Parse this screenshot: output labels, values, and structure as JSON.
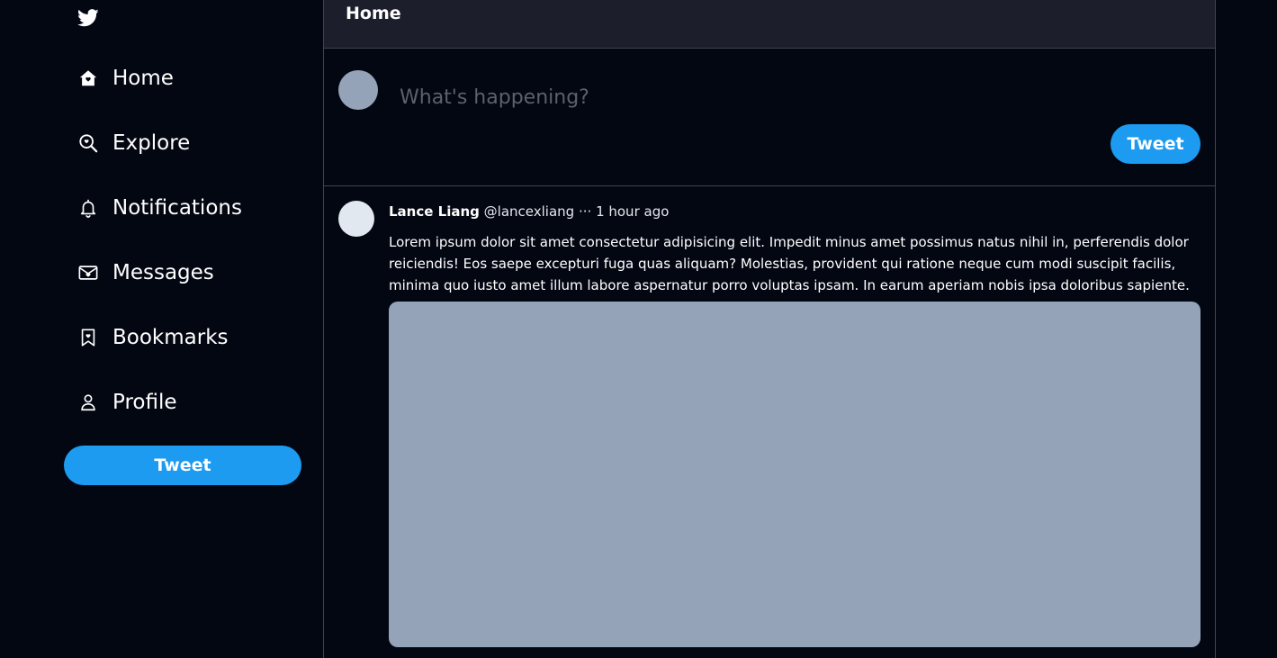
{
  "sidebar": {
    "logo_icon": "twitter-bird-icon",
    "items": [
      {
        "label": "Home",
        "icon": "home-icon"
      },
      {
        "label": "Explore",
        "icon": "explore-search-icon"
      },
      {
        "label": "Notifications",
        "icon": "bell-icon"
      },
      {
        "label": "Messages",
        "icon": "envelope-icon"
      },
      {
        "label": "Bookmarks",
        "icon": "bookmark-icon"
      },
      {
        "label": "Profile",
        "icon": "user-icon"
      }
    ],
    "tweet_button": "Tweet"
  },
  "header": {
    "title": "Home"
  },
  "composer": {
    "placeholder": "What's happening?",
    "tweet_button": "Tweet"
  },
  "tweet": {
    "name": "Lance Liang",
    "handle": "@lancexliang",
    "separator": "···",
    "time": "1 hour ago",
    "body": "Lorem ipsum dolor sit amet consectetur adipisicing elit. Impedit minus amet possimus natus nihil in, perferendis dolor reiciendis! Eos saepe excepturi fuga quas aliquam? Molestias, provident qui ratione neque cum modi suscipit facilis, minima quo iusto amet illum labore aspernatur porro voluptas ipsam. In earum aperiam nobis ipsa doloribus sapiente."
  },
  "colors": {
    "background": "#030712",
    "accent": "#1d9bf0",
    "header_bg": "#1c1f2b",
    "border": "#3f4450",
    "media_placeholder": "#94a3b8",
    "avatar_light": "#e2e8f0"
  }
}
